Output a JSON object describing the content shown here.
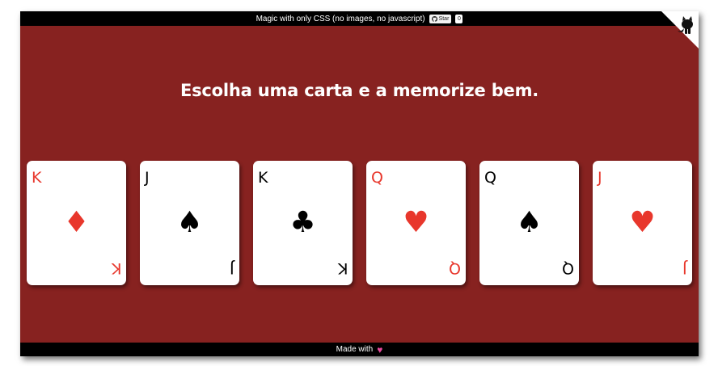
{
  "topbar": {
    "text": "Magic with only CSS (no images, no javascript)",
    "star_label": "Star",
    "star_count": "0"
  },
  "heading": "Escolha uma carta e a memorize bem.",
  "cards": [
    {
      "rank": "K",
      "suit": "♦",
      "suit_name": "diamonds",
      "color": "#e8372c"
    },
    {
      "rank": "J",
      "suit": "♠",
      "suit_name": "spades",
      "color": "#000000"
    },
    {
      "rank": "K",
      "suit": "♣",
      "suit_name": "clubs",
      "color": "#000000"
    },
    {
      "rank": "Q",
      "suit": "♥",
      "suit_name": "hearts",
      "color": "#e8372c"
    },
    {
      "rank": "Q",
      "suit": "♠",
      "suit_name": "spades",
      "color": "#000000"
    },
    {
      "rank": "J",
      "suit": "♥",
      "suit_name": "hearts",
      "color": "#e8372c"
    }
  ],
  "footer": {
    "text": "Made with",
    "icon": "heart-icon"
  },
  "colors": {
    "background": "#872220",
    "bars": "#000000",
    "red_suit": "#e8372c",
    "heart": "#e84a9e"
  }
}
